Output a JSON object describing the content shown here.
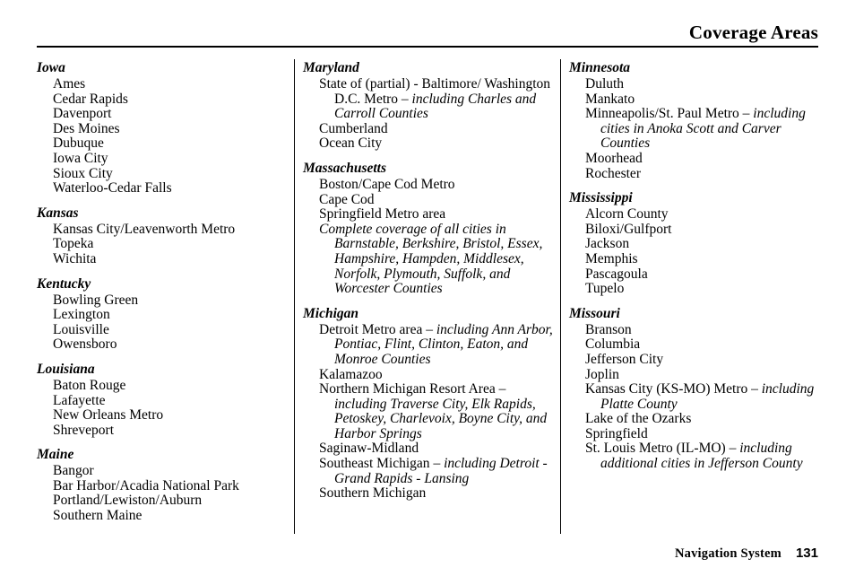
{
  "header": {
    "title": "Coverage Areas"
  },
  "footer": {
    "book_title": "Navigation System",
    "page_number": "131"
  },
  "columns": [
    {
      "states": [
        {
          "name": "Iowa",
          "entries": [
            {
              "text": "Ames"
            },
            {
              "text": "Cedar Rapids"
            },
            {
              "text": "Davenport"
            },
            {
              "text": "Des Moines"
            },
            {
              "text": "Dubuque"
            },
            {
              "text": "Iowa City"
            },
            {
              "text": "Sioux City"
            },
            {
              "text": "Waterloo-Cedar Falls"
            }
          ]
        },
        {
          "name": "Kansas",
          "entries": [
            {
              "text": "Kansas City/Leavenworth Metro"
            },
            {
              "text": "Topeka"
            },
            {
              "text": "Wichita"
            }
          ]
        },
        {
          "name": "Kentucky",
          "entries": [
            {
              "text": "Bowling Green"
            },
            {
              "text": "Lexington"
            },
            {
              "text": "Louisville"
            },
            {
              "text": "Owensboro"
            }
          ]
        },
        {
          "name": "Louisiana",
          "entries": [
            {
              "text": "Baton Rouge"
            },
            {
              "text": "Lafayette"
            },
            {
              "text": "New Orleans Metro"
            },
            {
              "text": "Shreveport"
            }
          ]
        },
        {
          "name": "Maine",
          "entries": [
            {
              "text": "Bangor"
            },
            {
              "text": "Bar Harbor/Acadia National Park"
            },
            {
              "text": "Portland/Lewiston/Auburn"
            },
            {
              "text": "Southern Maine"
            }
          ]
        }
      ]
    },
    {
      "states": [
        {
          "name": "Maryland",
          "entries": [
            {
              "text": "State of (partial) - Baltimore/ Washington D.C. Metro ",
              "emphasis": "– including Charles and Carroll Counties"
            },
            {
              "text": "Cumberland"
            },
            {
              "text": "Ocean City"
            }
          ]
        },
        {
          "name": "Massachusetts",
          "entries": [
            {
              "text": "Boston/Cape Cod Metro"
            },
            {
              "text": "Cape Cod"
            },
            {
              "text": "Springfield Metro area"
            },
            {
              "text": "Complete coverage of all cities in Barnstable, Berkshire, Bristol, Essex, Hampshire, Hampden, Middlesex, Norfolk, Plymouth, Suffolk, and Worcester Counties",
              "italic": true
            }
          ]
        },
        {
          "name": "Michigan",
          "entries": [
            {
              "text": "Detroit Metro area ",
              "emphasis": "– including Ann Arbor, Pontiac, Flint, Clinton, Eaton, and Monroe Counties"
            },
            {
              "text": "Kalamazoo"
            },
            {
              "text": "Northern Michigan Resort Area ",
              "emphasis": "– including Traverse City, Elk Rapids, Petoskey, Charlevoix, Boyne City, and Harbor Springs"
            },
            {
              "text": "Saginaw-Midland"
            },
            {
              "text": "Southeast Michigan ",
              "emphasis": "– including Detroit - Grand Rapids - Lansing"
            },
            {
              "text": "Southern Michigan"
            }
          ]
        }
      ]
    },
    {
      "states": [
        {
          "name": "Minnesota",
          "entries": [
            {
              "text": "Duluth"
            },
            {
              "text": "Mankato"
            },
            {
              "text": "Minneapolis/St. Paul Metro ",
              "emphasis": "– including cities in Anoka Scott and Carver Counties"
            },
            {
              "text": "Moorhead"
            },
            {
              "text": "Rochester"
            }
          ]
        },
        {
          "name": "Mississippi",
          "entries": [
            {
              "text": "Alcorn County"
            },
            {
              "text": "Biloxi/Gulfport"
            },
            {
              "text": "Jackson"
            },
            {
              "text": "Memphis"
            },
            {
              "text": "Pascagoula"
            },
            {
              "text": "Tupelo"
            }
          ]
        },
        {
          "name": "Missouri",
          "entries": [
            {
              "text": "Branson"
            },
            {
              "text": "Columbia"
            },
            {
              "text": "Jefferson City"
            },
            {
              "text": "Joplin"
            },
            {
              "text": "Kansas City (KS-MO) Metro ",
              "emphasis": "– including Platte County"
            },
            {
              "text": "Lake of the Ozarks"
            },
            {
              "text": "Springfield"
            },
            {
              "text": "St. Louis Metro (IL-MO) ",
              "emphasis": "– including additional cities in Jefferson County"
            }
          ]
        }
      ]
    }
  ]
}
